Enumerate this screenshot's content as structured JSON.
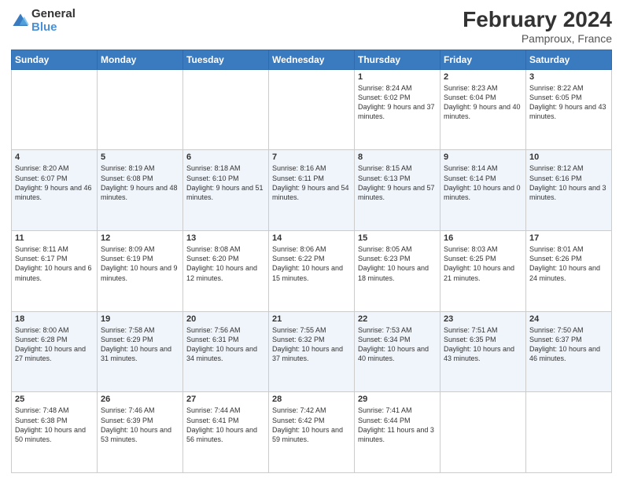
{
  "header": {
    "logo_line1": "General",
    "logo_line2": "Blue",
    "title": "February 2024",
    "subtitle": "Pamproux, France"
  },
  "weekdays": [
    "Sunday",
    "Monday",
    "Tuesday",
    "Wednesday",
    "Thursday",
    "Friday",
    "Saturday"
  ],
  "weeks": [
    [
      {
        "day": "",
        "info": ""
      },
      {
        "day": "",
        "info": ""
      },
      {
        "day": "",
        "info": ""
      },
      {
        "day": "",
        "info": ""
      },
      {
        "day": "1",
        "info": "Sunrise: 8:24 AM\nSunset: 6:02 PM\nDaylight: 9 hours and 37 minutes."
      },
      {
        "day": "2",
        "info": "Sunrise: 8:23 AM\nSunset: 6:04 PM\nDaylight: 9 hours and 40 minutes."
      },
      {
        "day": "3",
        "info": "Sunrise: 8:22 AM\nSunset: 6:05 PM\nDaylight: 9 hours and 43 minutes."
      }
    ],
    [
      {
        "day": "4",
        "info": "Sunrise: 8:20 AM\nSunset: 6:07 PM\nDaylight: 9 hours and 46 minutes."
      },
      {
        "day": "5",
        "info": "Sunrise: 8:19 AM\nSunset: 6:08 PM\nDaylight: 9 hours and 48 minutes."
      },
      {
        "day": "6",
        "info": "Sunrise: 8:18 AM\nSunset: 6:10 PM\nDaylight: 9 hours and 51 minutes."
      },
      {
        "day": "7",
        "info": "Sunrise: 8:16 AM\nSunset: 6:11 PM\nDaylight: 9 hours and 54 minutes."
      },
      {
        "day": "8",
        "info": "Sunrise: 8:15 AM\nSunset: 6:13 PM\nDaylight: 9 hours and 57 minutes."
      },
      {
        "day": "9",
        "info": "Sunrise: 8:14 AM\nSunset: 6:14 PM\nDaylight: 10 hours and 0 minutes."
      },
      {
        "day": "10",
        "info": "Sunrise: 8:12 AM\nSunset: 6:16 PM\nDaylight: 10 hours and 3 minutes."
      }
    ],
    [
      {
        "day": "11",
        "info": "Sunrise: 8:11 AM\nSunset: 6:17 PM\nDaylight: 10 hours and 6 minutes."
      },
      {
        "day": "12",
        "info": "Sunrise: 8:09 AM\nSunset: 6:19 PM\nDaylight: 10 hours and 9 minutes."
      },
      {
        "day": "13",
        "info": "Sunrise: 8:08 AM\nSunset: 6:20 PM\nDaylight: 10 hours and 12 minutes."
      },
      {
        "day": "14",
        "info": "Sunrise: 8:06 AM\nSunset: 6:22 PM\nDaylight: 10 hours and 15 minutes."
      },
      {
        "day": "15",
        "info": "Sunrise: 8:05 AM\nSunset: 6:23 PM\nDaylight: 10 hours and 18 minutes."
      },
      {
        "day": "16",
        "info": "Sunrise: 8:03 AM\nSunset: 6:25 PM\nDaylight: 10 hours and 21 minutes."
      },
      {
        "day": "17",
        "info": "Sunrise: 8:01 AM\nSunset: 6:26 PM\nDaylight: 10 hours and 24 minutes."
      }
    ],
    [
      {
        "day": "18",
        "info": "Sunrise: 8:00 AM\nSunset: 6:28 PM\nDaylight: 10 hours and 27 minutes."
      },
      {
        "day": "19",
        "info": "Sunrise: 7:58 AM\nSunset: 6:29 PM\nDaylight: 10 hours and 31 minutes."
      },
      {
        "day": "20",
        "info": "Sunrise: 7:56 AM\nSunset: 6:31 PM\nDaylight: 10 hours and 34 minutes."
      },
      {
        "day": "21",
        "info": "Sunrise: 7:55 AM\nSunset: 6:32 PM\nDaylight: 10 hours and 37 minutes."
      },
      {
        "day": "22",
        "info": "Sunrise: 7:53 AM\nSunset: 6:34 PM\nDaylight: 10 hours and 40 minutes."
      },
      {
        "day": "23",
        "info": "Sunrise: 7:51 AM\nSunset: 6:35 PM\nDaylight: 10 hours and 43 minutes."
      },
      {
        "day": "24",
        "info": "Sunrise: 7:50 AM\nSunset: 6:37 PM\nDaylight: 10 hours and 46 minutes."
      }
    ],
    [
      {
        "day": "25",
        "info": "Sunrise: 7:48 AM\nSunset: 6:38 PM\nDaylight: 10 hours and 50 minutes."
      },
      {
        "day": "26",
        "info": "Sunrise: 7:46 AM\nSunset: 6:39 PM\nDaylight: 10 hours and 53 minutes."
      },
      {
        "day": "27",
        "info": "Sunrise: 7:44 AM\nSunset: 6:41 PM\nDaylight: 10 hours and 56 minutes."
      },
      {
        "day": "28",
        "info": "Sunrise: 7:42 AM\nSunset: 6:42 PM\nDaylight: 10 hours and 59 minutes."
      },
      {
        "day": "29",
        "info": "Sunrise: 7:41 AM\nSunset: 6:44 PM\nDaylight: 11 hours and 3 minutes."
      },
      {
        "day": "",
        "info": ""
      },
      {
        "day": "",
        "info": ""
      }
    ]
  ]
}
